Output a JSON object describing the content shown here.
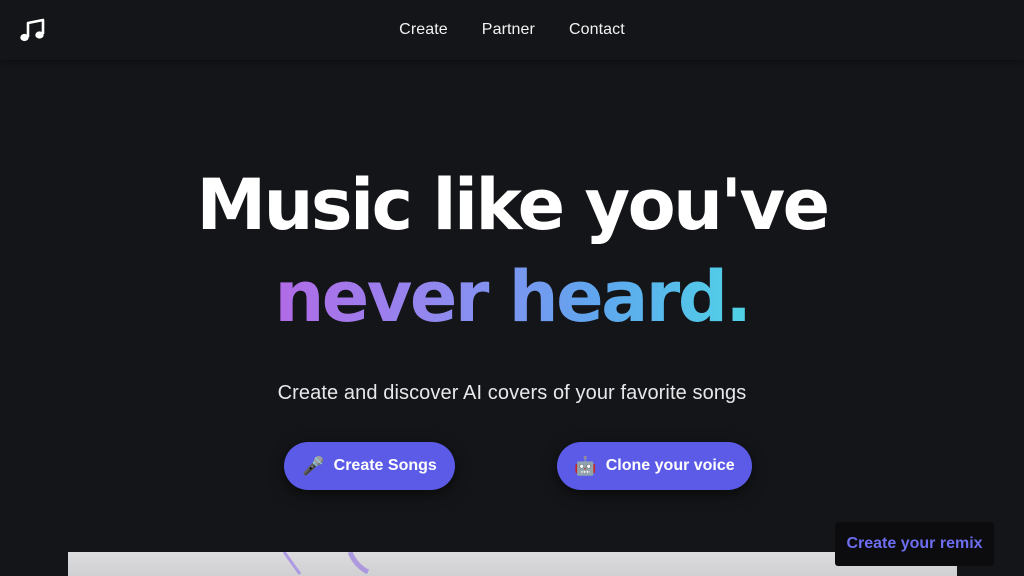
{
  "header": {
    "logo_icon": "music-note-icon",
    "nav": [
      {
        "label": "Create"
      },
      {
        "label": "Partner"
      },
      {
        "label": "Contact"
      }
    ]
  },
  "hero": {
    "title_line1": "Music like you've",
    "title_line2": "never heard.",
    "subtitle": "Create and discover AI covers of your favorite songs",
    "gradient_colors": [
      "#b26ae6",
      "#8d8cf0",
      "#5fa6ee",
      "#4fd4e6"
    ]
  },
  "buttons": {
    "create_songs": {
      "label": "Create Songs",
      "icon": "microphone-icon",
      "glyph": "🎤"
    },
    "clone_voice": {
      "label": "Clone your voice",
      "icon": "robot-icon",
      "glyph": "🤖"
    },
    "accent_color": "#5b5be8"
  },
  "floating": {
    "remix_label": "Create your remix",
    "remix_color": "#6d6df0"
  },
  "colors": {
    "background": "#141518",
    "text": "#ffffff"
  }
}
